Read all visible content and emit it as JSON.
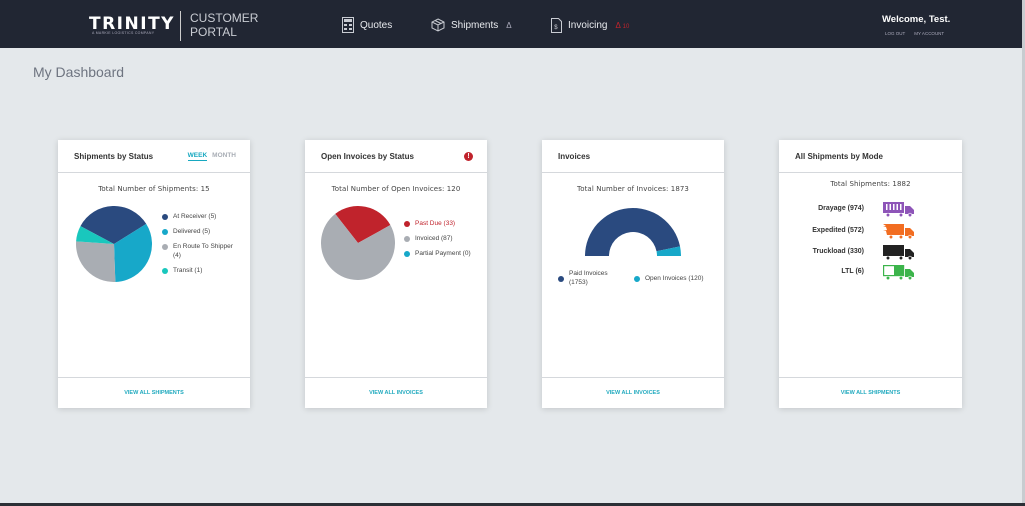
{
  "header": {
    "logo_text": "TRINITY",
    "logo_tagline": "A MARKIE LOGISTICS COMPANY",
    "portal_line1": "CUSTOMER",
    "portal_line2": "PORTAL",
    "nav": [
      {
        "label": "Quotes",
        "icon": "calculator-icon"
      },
      {
        "label": "Shipments",
        "icon": "box-icon",
        "bell": "Δ"
      },
      {
        "label": "Invoicing",
        "icon": "invoice-icon",
        "bell": "Δ",
        "bell_count": "10"
      }
    ],
    "welcome": "Welcome, Test.",
    "logout_label": "LOG OUT",
    "account_label": "MY ACCOUNT"
  },
  "page": {
    "title": "My Dashboard"
  },
  "cards": {
    "shipments_status": {
      "title": "Shipments by Status",
      "tab_week": "WEEK",
      "tab_month": "MONTH",
      "total": "Total Number of Shipments: 15",
      "footer": "VIEW ALL SHIPMENTS"
    },
    "open_invoices": {
      "title": "Open Invoices by Status",
      "alert": "!",
      "total": "Total Number of Open Invoices: 120",
      "footer": "VIEW ALL INVOICES"
    },
    "invoices": {
      "title": "Invoices",
      "total": "Total Number of Invoices: 1873",
      "footer": "VIEW ALL INVOICES"
    },
    "modes": {
      "title": "All Shipments by Mode",
      "total": "Total Shipments: 1882",
      "rows": [
        {
          "label": "Drayage (974)",
          "color": "#8e55b8"
        },
        {
          "label": "Expedited (572)",
          "color": "#f26d21"
        },
        {
          "label": "Truckload (330)",
          "color": "#222222"
        },
        {
          "label": "LTL (6)",
          "color": "#3cb44b"
        }
      ],
      "footer": "VIEW ALL SHIPMENTS"
    }
  },
  "chart_data": [
    {
      "type": "pie",
      "title": "Shipments by Status",
      "categories": [
        "At Receiver",
        "Delivered",
        "En Route To Shipper",
        "Transit"
      ],
      "values": [
        5,
        5,
        4,
        1
      ],
      "legend_labels": [
        "At Receiver (5)",
        "Delivered (5)",
        "En Route To Shipper (4)",
        "Transit (1)"
      ],
      "colors": [
        "#2a4a7f",
        "#17a8c9",
        "#a9adb3",
        "#19c7bd"
      ],
      "legend": "right"
    },
    {
      "type": "pie",
      "title": "Open Invoices by Status",
      "categories": [
        "Past Due",
        "Invoiced",
        "Partial Payment"
      ],
      "values": [
        33,
        87,
        0
      ],
      "legend_labels": [
        "Past Due (33)",
        "Invoiced (87)",
        "Partial Payment (0)"
      ],
      "colors": [
        "#c0232c",
        "#a9adb3",
        "#17a8c9"
      ],
      "legend": "right"
    },
    {
      "type": "pie",
      "subtype": "semi-donut",
      "title": "Invoices",
      "categories": [
        "Paid Invoices",
        "Open Invoices"
      ],
      "values": [
        1753,
        120
      ],
      "legend_labels": [
        "Paid Invoices (1753)",
        "Open Invoices (120)"
      ],
      "colors": [
        "#2a4a7f",
        "#17a8c9"
      ],
      "legend": "bottom"
    }
  ]
}
